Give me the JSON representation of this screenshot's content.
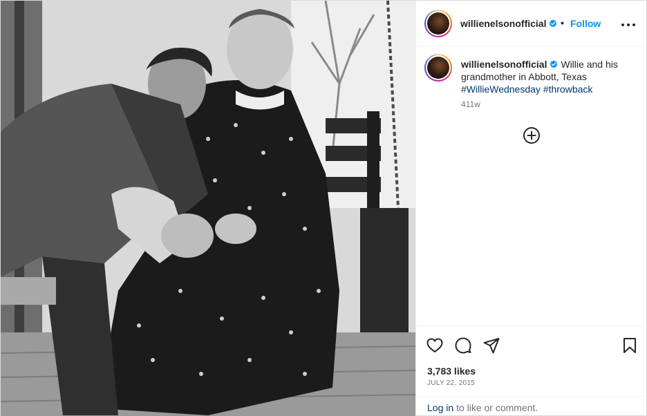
{
  "post": {
    "photo_alt": "Black and white photo of Willie Nelson with his grandmother on a porch swing",
    "colors": {
      "accent": "#0095f6",
      "hashtag": "#00376b",
      "text": "#262626",
      "muted": "#737373",
      "verified": "#0095f6"
    }
  },
  "header": {
    "username": "willienelsonofficial",
    "separator": "•",
    "follow_label": "Follow",
    "more_icon": "more-horizontal-icon"
  },
  "caption": {
    "username": "willienelsonofficial",
    "text": "Willie and his grandmother in Abbott, Texas",
    "hashtags": [
      "#WillieWednesday",
      "#throwback"
    ],
    "age": "411w"
  },
  "actions": {
    "icons": [
      "heart-icon",
      "comment-icon",
      "share-icon",
      "bookmark-icon"
    ],
    "likes": "3,783 likes",
    "date": "JULY 22, 2015"
  },
  "login": {
    "link_text": "Log in",
    "rest_text": " to like or comment."
  }
}
